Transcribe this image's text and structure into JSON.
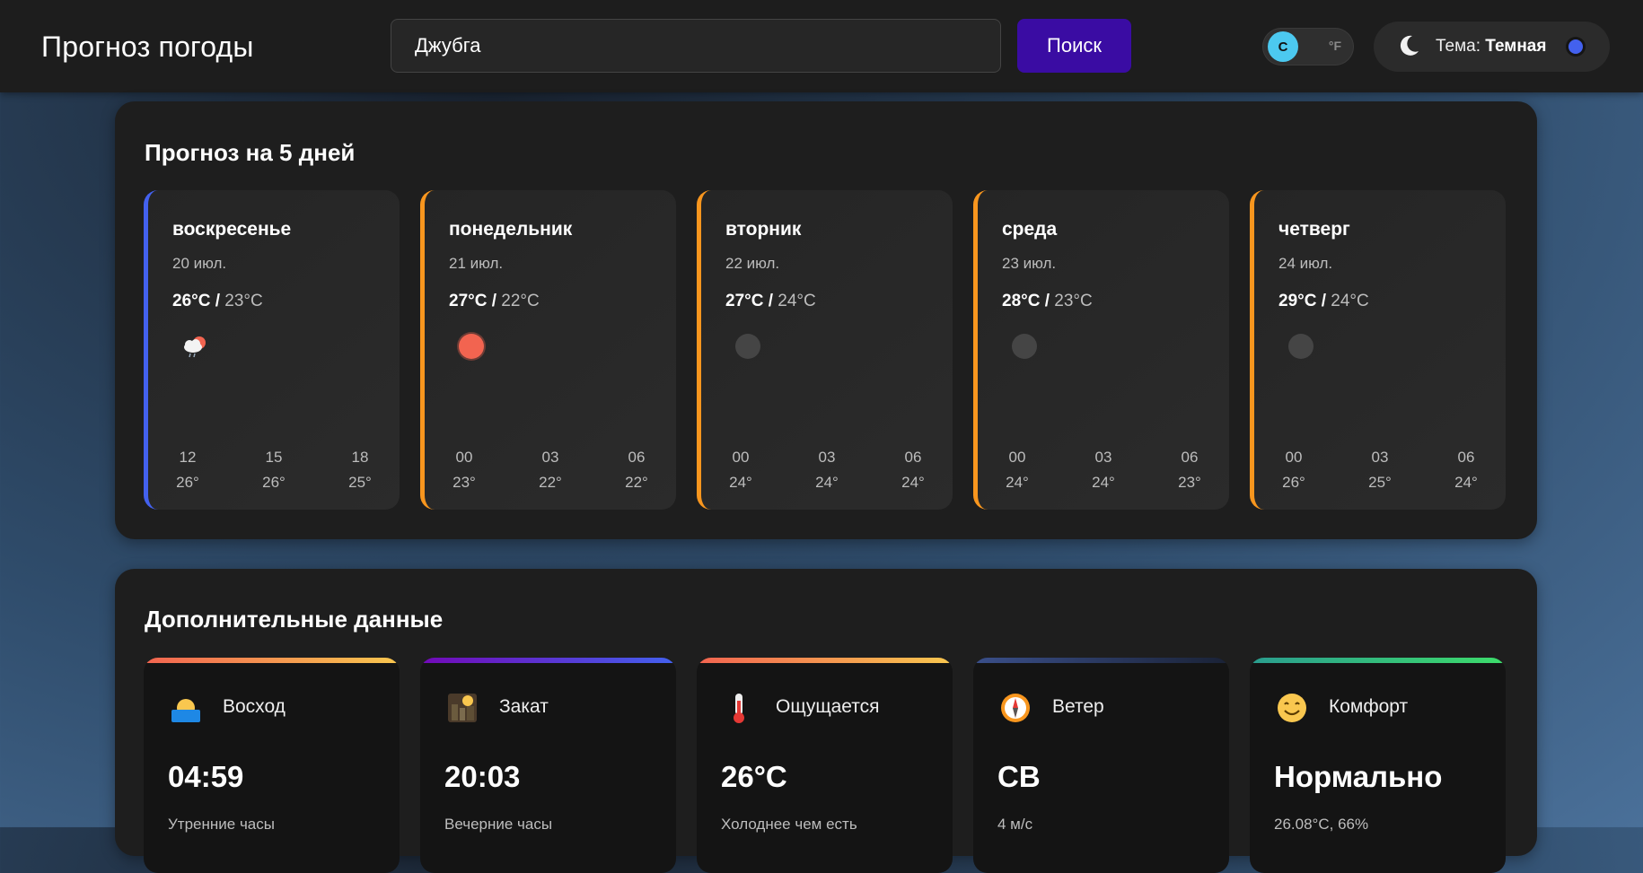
{
  "header": {
    "title": "Прогноз погоды",
    "search_value": "Джубга",
    "search_button": "Поиск",
    "unit_c": "C",
    "unit_f": "°F",
    "theme_prefix": "Тема:",
    "theme_value": "Темная"
  },
  "forecast": {
    "title": "Прогноз на 5 дней",
    "days": [
      {
        "name": "воскресенье",
        "date": "20 июл.",
        "max": "26°C",
        "min": "23°C",
        "icon": "cloud-sun-rain-icon",
        "hours": [
          {
            "h": "12",
            "t": "26°"
          },
          {
            "h": "15",
            "t": "26°"
          },
          {
            "h": "18",
            "t": "25°"
          }
        ]
      },
      {
        "name": "понедельник",
        "date": "21 июл.",
        "max": "27°C",
        "min": "22°C",
        "icon": "sun-icon",
        "hours": [
          {
            "h": "00",
            "t": "23°"
          },
          {
            "h": "03",
            "t": "22°"
          },
          {
            "h": "06",
            "t": "22°"
          }
        ]
      },
      {
        "name": "вторник",
        "date": "22 июл.",
        "max": "27°C",
        "min": "24°C",
        "icon": "clear-night-icon",
        "hours": [
          {
            "h": "00",
            "t": "24°"
          },
          {
            "h": "03",
            "t": "24°"
          },
          {
            "h": "06",
            "t": "24°"
          }
        ]
      },
      {
        "name": "среда",
        "date": "23 июл.",
        "max": "28°C",
        "min": "23°C",
        "icon": "clear-night-icon",
        "hours": [
          {
            "h": "00",
            "t": "24°"
          },
          {
            "h": "03",
            "t": "24°"
          },
          {
            "h": "06",
            "t": "23°"
          }
        ]
      },
      {
        "name": "четверг",
        "date": "24 июл.",
        "max": "29°C",
        "min": "24°C",
        "icon": "clear-night-icon",
        "hours": [
          {
            "h": "00",
            "t": "26°"
          },
          {
            "h": "03",
            "t": "25°"
          },
          {
            "h": "06",
            "t": "24°"
          }
        ]
      }
    ]
  },
  "extra": {
    "title": "Дополнительные данные",
    "cards": [
      {
        "label": "Восход",
        "value": "04:59",
        "sub": "Утренние часы",
        "icon": "sunrise-icon"
      },
      {
        "label": "Закат",
        "value": "20:03",
        "sub": "Вечерние часы",
        "icon": "sunset-icon"
      },
      {
        "label": "Ощущается",
        "value": "26°C",
        "sub": "Холоднее чем есть",
        "icon": "thermometer-icon"
      },
      {
        "label": "Ветер",
        "value": "СВ",
        "sub": "4 м/с",
        "icon": "compass-icon"
      },
      {
        "label": "Комфорт",
        "value": "Нормально",
        "sub": "26.08°C, 66%",
        "icon": "smile-icon"
      }
    ]
  },
  "colors": {
    "accent": "#3a0ca3",
    "today_border": "#4361ee",
    "day_border": "#f8961e",
    "unit_active": "#4cc9f0"
  }
}
